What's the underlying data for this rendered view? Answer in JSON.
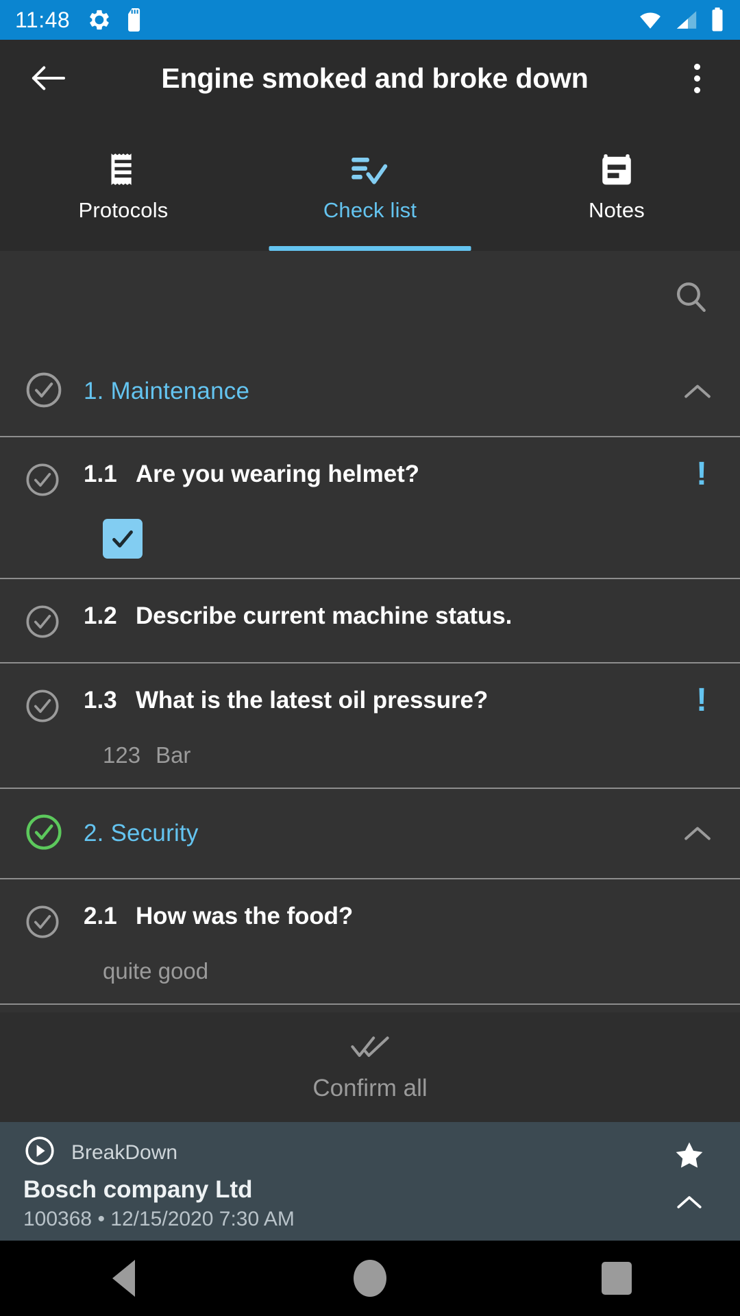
{
  "status_bar": {
    "time": "11:48",
    "icons": [
      "settings-gear-icon",
      "sd-card-icon",
      "wifi-icon",
      "cellular-signal-icon",
      "battery-icon"
    ],
    "background": "#0b85d0"
  },
  "app_bar": {
    "back_label": "back-arrow",
    "title": "Engine smoked and broke down",
    "overflow_label": "more-options"
  },
  "tabs": {
    "items": [
      {
        "label": "Protocols",
        "icon": "receipt-icon",
        "active": false
      },
      {
        "label": "Check list",
        "icon": "checklist-icon",
        "active": true
      },
      {
        "label": "Notes",
        "icon": "note-icon",
        "active": false
      }
    ],
    "active_color": "#64c4f0"
  },
  "toolbar": {
    "search_icon": "search-icon"
  },
  "checklist": {
    "sections": [
      {
        "title": "1. Maintenance",
        "status": "pending",
        "status_color": "#9b9b9b",
        "expanded": true,
        "items": [
          {
            "number": "1.1",
            "text": "Are you wearing helmet?",
            "required": true,
            "answer_type": "checkbox",
            "checked": true
          },
          {
            "number": "1.2",
            "text": "Describe current machine status.",
            "required": false,
            "answer_type": "none"
          },
          {
            "number": "1.3",
            "text": "What is the latest oil pressure?",
            "required": true,
            "answer_type": "number",
            "value": "123",
            "unit": "Bar"
          }
        ]
      },
      {
        "title": "2. Security",
        "status": "complete",
        "status_color": "#5cc95c",
        "expanded": true,
        "items": [
          {
            "number": "2.1",
            "text": "How was the food?",
            "required": false,
            "answer_type": "text",
            "value": "quite good"
          }
        ]
      }
    ],
    "required_marker": "!"
  },
  "confirm": {
    "label": "Confirm all",
    "icon": "double-check-icon"
  },
  "bottom_bar": {
    "type": "BreakDown",
    "company": "Bosch company Ltd",
    "meta": "100368 • 12/15/2020 7:30 AM",
    "play_icon": "play-circle-icon",
    "star_icon": "star-icon",
    "chevron_icon": "chevron-up-icon",
    "background": "#3c4a52"
  },
  "nav_bar": {
    "buttons": [
      "back-triangle",
      "home-circle",
      "recents-square"
    ]
  }
}
